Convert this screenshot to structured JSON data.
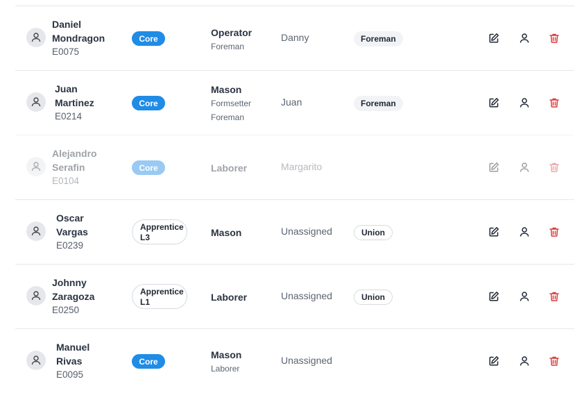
{
  "rows": [
    {
      "name_first": "Daniel",
      "name_last": "Mondragon",
      "id": "E0075",
      "badge": "Core",
      "role": "Operator",
      "role_sub": [
        "Foreman"
      ],
      "nickname": "Danny",
      "tag": "Foreman",
      "tag_style": "filled",
      "muted": false
    },
    {
      "name_first": "Juan",
      "name_last": "Martinez",
      "id": "E0214",
      "badge": "Core",
      "role": "Mason",
      "role_sub": [
        "Formsetter",
        "Foreman"
      ],
      "nickname": "Juan",
      "tag": "Foreman",
      "tag_style": "filled",
      "muted": false
    },
    {
      "name_first": "Alejandro",
      "name_last": "Serafin",
      "id": "E0104",
      "badge": "Core",
      "role": "Laborer",
      "role_sub": [],
      "nickname": "Margarito",
      "tag": "",
      "muted": true
    },
    {
      "name_first": "Oscar",
      "name_last": "Vargas",
      "id": "E0239",
      "badge": "Apprentice L3",
      "badge_line1": "Apprentice",
      "badge_line2": "L3",
      "role": "Mason",
      "role_sub": [],
      "nickname": "Unassigned",
      "tag": "Union",
      "tag_style": "outline",
      "muted": false
    },
    {
      "name_first": "Johnny",
      "name_last": "Zaragoza",
      "id": "E0250",
      "badge": "Apprentice L1",
      "badge_line1": "Apprentice",
      "badge_line2": "L1",
      "role": "Laborer",
      "role_sub": [],
      "nickname": "Unassigned",
      "tag": "Union",
      "tag_style": "outline",
      "muted": false
    },
    {
      "name_first": "Manuel",
      "name_last": "Rivas",
      "id": "E0095",
      "badge": "Core",
      "role": "Mason",
      "role_sub": [
        "Laborer"
      ],
      "nickname": "Unassigned",
      "tag": "",
      "muted": false
    }
  ],
  "icons": {
    "edit": "edit-icon",
    "user": "user-icon",
    "delete": "trash-icon",
    "avatar": "person-icon"
  },
  "colors": {
    "core": "#1f8ce6",
    "delete": "#dc3b3b",
    "avatar_bg": "#e5e7eb"
  }
}
